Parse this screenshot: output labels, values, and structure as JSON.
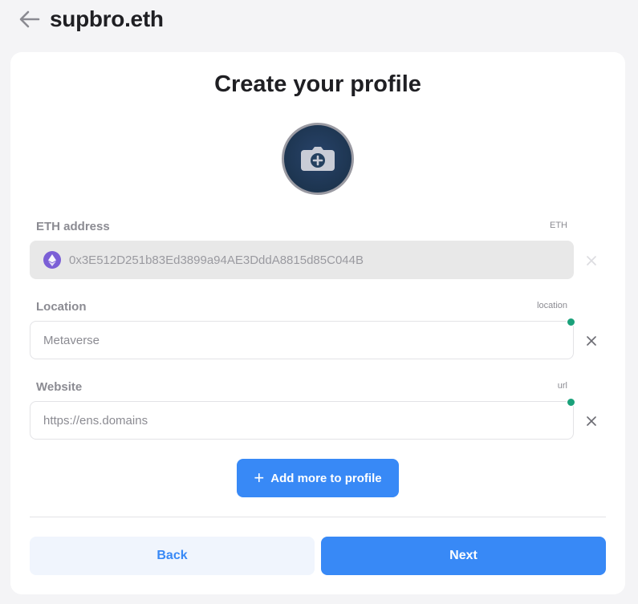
{
  "header": {
    "title": "supbro.eth"
  },
  "card": {
    "title": "Create your profile",
    "fields": [
      {
        "label": "ETH address",
        "tag": "ETH",
        "value": "0x3E512D251b83Ed3899a94AE3DddA8815d85C044B"
      },
      {
        "label": "Location",
        "tag": "location",
        "value": "Metaverse"
      },
      {
        "label": "Website",
        "tag": "url",
        "value": "https://ens.domains"
      }
    ],
    "add_more_label": "Add more to profile",
    "back_label": "Back",
    "next_label": "Next"
  },
  "colors": {
    "accent": "#3889f6",
    "success": "#1aa17a",
    "eth": "#7b5fd6"
  },
  "icons": [
    "back-arrow-icon",
    "camera-plus-icon",
    "ethereum-icon",
    "close-icon",
    "plus-icon"
  ]
}
